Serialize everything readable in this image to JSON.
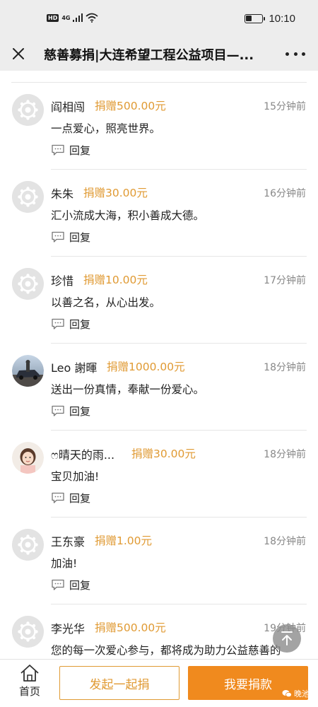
{
  "status_bar": {
    "hd": "HD",
    "network": "4G",
    "time": "10:10"
  },
  "header": {
    "title": "慈善募捐|大连希望工程公益项目—..."
  },
  "entries": [
    {
      "name": "阎相闯",
      "donation": "捐赠500.00元",
      "time": "15分钟前",
      "message": "一点爱心，照亮世界。",
      "reply": "回复",
      "avatar": "default"
    },
    {
      "name": "朱朱",
      "donation": "捐赠30.00元",
      "time": "16分钟前",
      "message": "汇小流成大海，积小善成大德。",
      "reply": "回复",
      "avatar": "default"
    },
    {
      "name": "珍惜",
      "donation": "捐赠10.00元",
      "time": "17分钟前",
      "message": "以善之名，从心出发。",
      "reply": "回复",
      "avatar": "default"
    },
    {
      "name": "Leo 謝暉",
      "donation": "捐赠1000.00元",
      "time": "18分钟前",
      "message": "送出一份真情，奉献一份爱心。",
      "reply": "回复",
      "avatar": "photo-car"
    },
    {
      "name": "ෆ晴天的雨...",
      "donation": "捐赠30.00元",
      "time": "18分钟前",
      "message": "宝贝加油!",
      "reply": "回复",
      "avatar": "photo-girl"
    },
    {
      "name": "王东豪",
      "donation": "捐赠1.00元",
      "time": "18分钟前",
      "message": "加油!",
      "reply": "回复",
      "avatar": "default"
    },
    {
      "name": "李光华",
      "donation": "捐赠500.00元",
      "time": "19分钟前",
      "message": "您的每一次爱心参与，都将成为助力公益慈善的",
      "reply": "",
      "avatar": "default"
    }
  ],
  "bottom_bar": {
    "home_label": "首页",
    "start_button": "发起一起捐",
    "donate_button": "我要捐款",
    "watermark": "晚池"
  },
  "colors": {
    "accent": "#e09a33",
    "donate_button": "#f08a1e",
    "header_bg": "#ededed"
  }
}
